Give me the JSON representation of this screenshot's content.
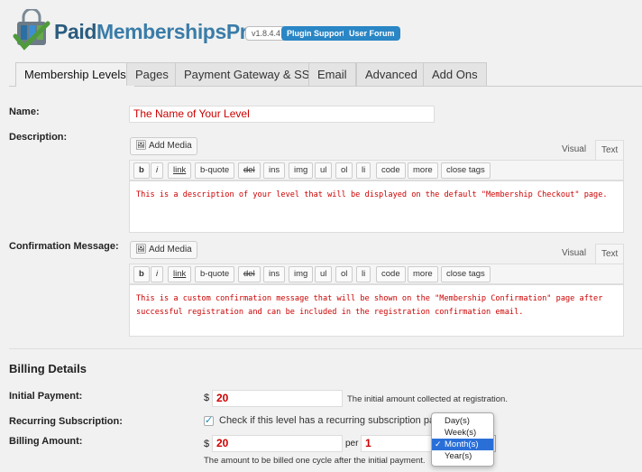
{
  "header": {
    "brand_part1": "Paid",
    "brand_part2": "MembershipsPro",
    "version": "v1.8.4.4",
    "support_label": "Plugin Support",
    "forum_label": "User Forum"
  },
  "tabs": [
    {
      "label": "Membership Levels",
      "active": true
    },
    {
      "label": "Pages"
    },
    {
      "label": "Payment Gateway & SSL"
    },
    {
      "label": "Email"
    },
    {
      "label": "Advanced"
    },
    {
      "label": "Add Ons"
    }
  ],
  "form": {
    "name_label": "Name:",
    "name_value": "The Name of Your Level",
    "description_label": "Description:",
    "confirmation_label": "Confirmation Message:",
    "add_media_label": "Add Media",
    "visual_tab": "Visual",
    "text_tab": "Text",
    "quicktags": [
      "b",
      "i",
      "link",
      "b-quote",
      "del",
      "ins",
      "img",
      "ul",
      "ol",
      "li",
      "code",
      "more",
      "close tags"
    ],
    "description_text": "This is a description of your level that will be displayed on the default \"Membership Checkout\" page.",
    "confirmation_text": "This is a custom confirmation message that will be shown on the \"Membership Confirmation\" page after successful registration and can be included in the registration confirmation email."
  },
  "billing": {
    "title": "Billing Details",
    "initial_payment_label": "Initial Payment:",
    "currency": "$",
    "initial_payment_value": "20",
    "initial_payment_hint": "The initial amount collected at registration.",
    "recurring_label": "Recurring Subscription:",
    "recurring_text": "Check if this level has a recurring subscription paym",
    "billing_amount_label": "Billing Amount:",
    "billing_amount_value": "20",
    "per_label": "per",
    "cycle_number": "1",
    "billing_hint": "The amount to be billed one cycle after the initial payment.",
    "period_options": [
      "Day(s)",
      "Week(s)",
      "Month(s)",
      "Year(s)"
    ],
    "period_selected": "Month(s)"
  }
}
